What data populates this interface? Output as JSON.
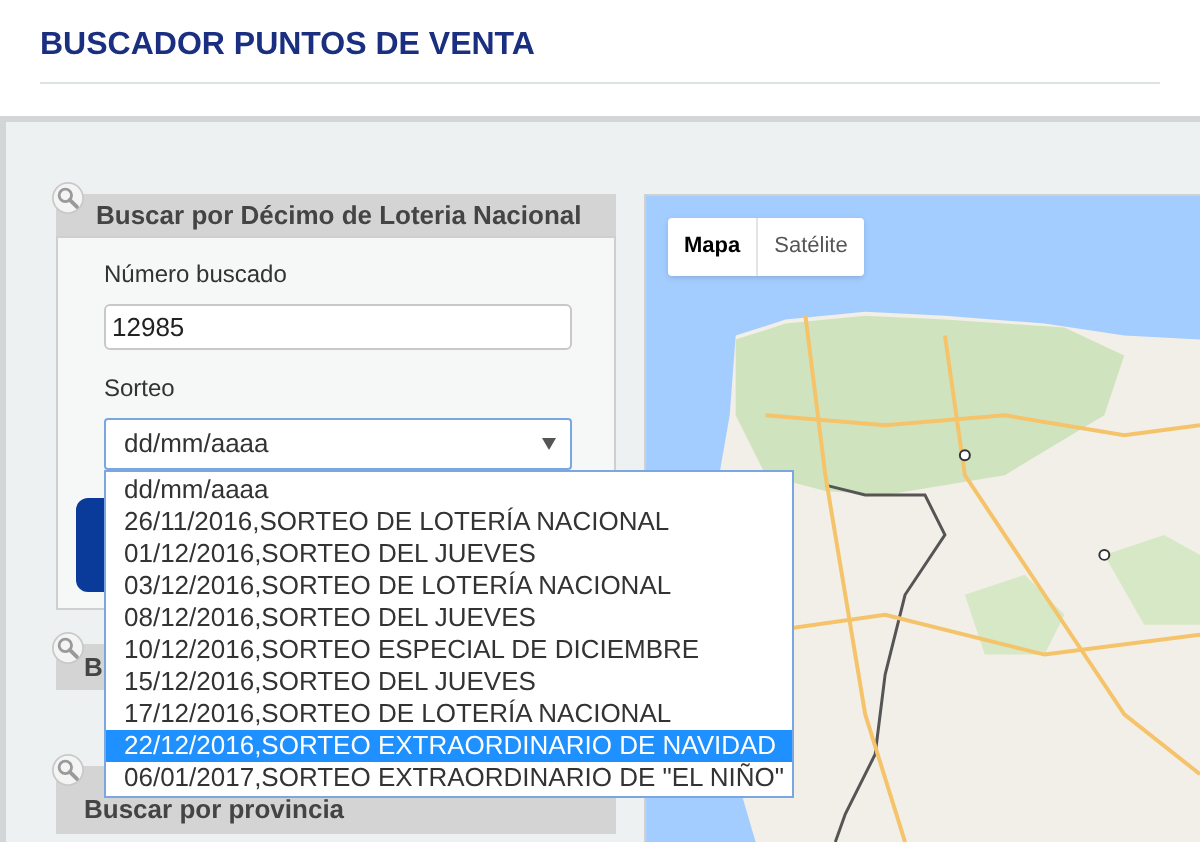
{
  "page_title": "BUSCADOR PUNTOS DE VENTA",
  "search_panels": [
    {
      "title": "Buscar por Décimo de Loteria Nacional"
    },
    {
      "title": "B"
    },
    {
      "title": "Buscar por provincia"
    }
  ],
  "form": {
    "number_label": "Número buscado",
    "number_value": "12985",
    "draw_label": "Sorteo",
    "draw_value": "dd/mm/aaaa",
    "draw_options": [
      {
        "label": "dd/mm/aaaa",
        "selected": false
      },
      {
        "label": "26/11/2016,SORTEO DE LOTERÍA NACIONAL",
        "selected": false
      },
      {
        "label": "01/12/2016,SORTEO DEL JUEVES",
        "selected": false
      },
      {
        "label": "03/12/2016,SORTEO DE LOTERÍA NACIONAL",
        "selected": false
      },
      {
        "label": "08/12/2016,SORTEO DEL JUEVES",
        "selected": false
      },
      {
        "label": "10/12/2016,SORTEO ESPECIAL DE DICIEMBRE",
        "selected": false
      },
      {
        "label": "15/12/2016,SORTEO DEL JUEVES",
        "selected": false
      },
      {
        "label": "17/12/2016,SORTEO DE LOTERÍA NACIONAL",
        "selected": false
      },
      {
        "label": "22/12/2016,SORTEO EXTRAORDINARIO DE NAVIDAD",
        "selected": true
      },
      {
        "label": "06/01/2017,SORTEO EXTRAORDINARIO DE \"EL NIÑO\"",
        "selected": false
      }
    ]
  },
  "map": {
    "map_types": [
      {
        "label": "Mapa",
        "selected": true
      },
      {
        "label": "Satélite",
        "selected": false
      }
    ]
  }
}
